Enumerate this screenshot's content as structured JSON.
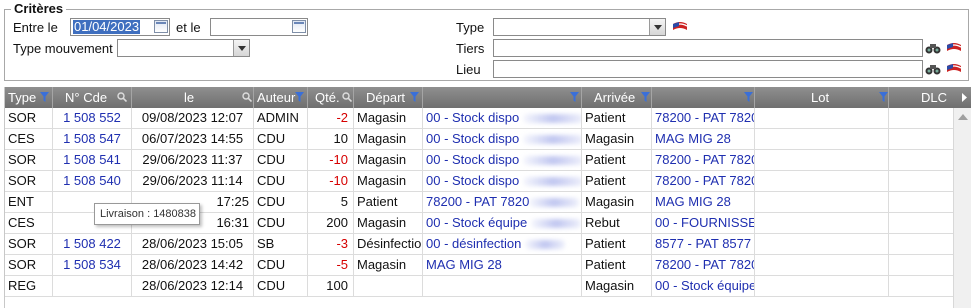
{
  "criteria": {
    "title": "Critères",
    "between_label": "Entre le",
    "date_from": "01/04/2023",
    "and_label": "et le",
    "date_to": "",
    "movement_type_label": "Type mouvement",
    "movement_type_value": "",
    "type_label": "Type",
    "type_value": "",
    "tiers_label": "Tiers",
    "tiers_value": "",
    "lieu_label": "Lieu",
    "lieu_value": ""
  },
  "table": {
    "columns": [
      "Type",
      "N° Cde",
      "le",
      "Auteur",
      "Qté.",
      "Départ",
      "",
      "Arrivée",
      "",
      "Lot",
      "DLC"
    ],
    "rows": [
      {
        "type": "SOR",
        "cde": "1 508 552",
        "date": "09/08/2023 12:07",
        "auteur": "ADMIN",
        "qte": "-2",
        "dep": "Magasin",
        "dep2": "00 - Stock dispo",
        "arr": "Patient",
        "arr2": "78200 - PAT 7820",
        "lot": "",
        "dlc": ""
      },
      {
        "type": "CES",
        "cde": "1 508 547",
        "date": "06/07/2023 14:55",
        "auteur": "CDU",
        "qte": "10",
        "dep": "Magasin",
        "dep2": "00 - Stock dispo",
        "arr": "Magasin",
        "arr2": "MAG MIG 28",
        "lot": "",
        "dlc": ""
      },
      {
        "type": "SOR",
        "cde": "1 508 541",
        "date": "29/06/2023 11:37",
        "auteur": "CDU",
        "qte": "-10",
        "dep": "Magasin",
        "dep2": "00 - Stock dispo",
        "arr": "Patient",
        "arr2": "78200 - PAT 7820",
        "lot": "",
        "dlc": ""
      },
      {
        "type": "SOR",
        "cde": "1 508 540",
        "date": "29/06/2023 11:14",
        "auteur": "CDU",
        "qte": "-10",
        "dep": "Magasin",
        "dep2": "00 - Stock dispo",
        "arr": "Patient",
        "arr2": "78200 - PAT 7820",
        "lot": "",
        "dlc": ""
      },
      {
        "type": "ENT",
        "cde": "",
        "date": "17:25",
        "auteur": "CDU",
        "qte": "5",
        "dep": "Patient",
        "dep2": "78200 - PAT 7820",
        "arr": "Magasin",
        "arr2": "MAG MIG 28",
        "lot": "",
        "dlc": ""
      },
      {
        "type": "CES",
        "cde": "",
        "date": "16:31",
        "auteur": "CDU",
        "qte": "200",
        "dep": "Magasin",
        "dep2": "00 - Stock équipe",
        "arr": "Rebut",
        "arr2": "00 - FOURNISSEU",
        "lot": "",
        "dlc": ""
      },
      {
        "type": "SOR",
        "cde": "1 508 422",
        "date": "28/06/2023 15:05",
        "auteur": "SB",
        "qte": "-3",
        "dep": "Désinfectio",
        "dep2": "00 - désinfection",
        "arr": "Patient",
        "arr2": "8577 - PAT 8577",
        "lot": "",
        "dlc": ""
      },
      {
        "type": "SOR",
        "cde": "1 508 534",
        "date": "28/06/2023 14:42",
        "auteur": "CDU",
        "qte": "-5",
        "dep": "Magasin",
        "dep2": "MAG MIG 28",
        "arr": "Patient",
        "arr2": "78200 - PAT 7820",
        "lot": "",
        "dlc": ""
      },
      {
        "type": "REG",
        "cde": "",
        "date": "28/06/2023 12:14",
        "auteur": "CDU",
        "qte": "100",
        "dep": "",
        "dep2": "",
        "arr": "Magasin",
        "arr2": "00 - Stock équipe",
        "lot": "",
        "dlc": ""
      }
    ]
  },
  "tooltip": "Livraison : 1480838",
  "colors": {
    "header": "#7f7f7f",
    "link": "#1f2fb0",
    "negative": "#d60000",
    "selection": "#3f6fbf"
  }
}
